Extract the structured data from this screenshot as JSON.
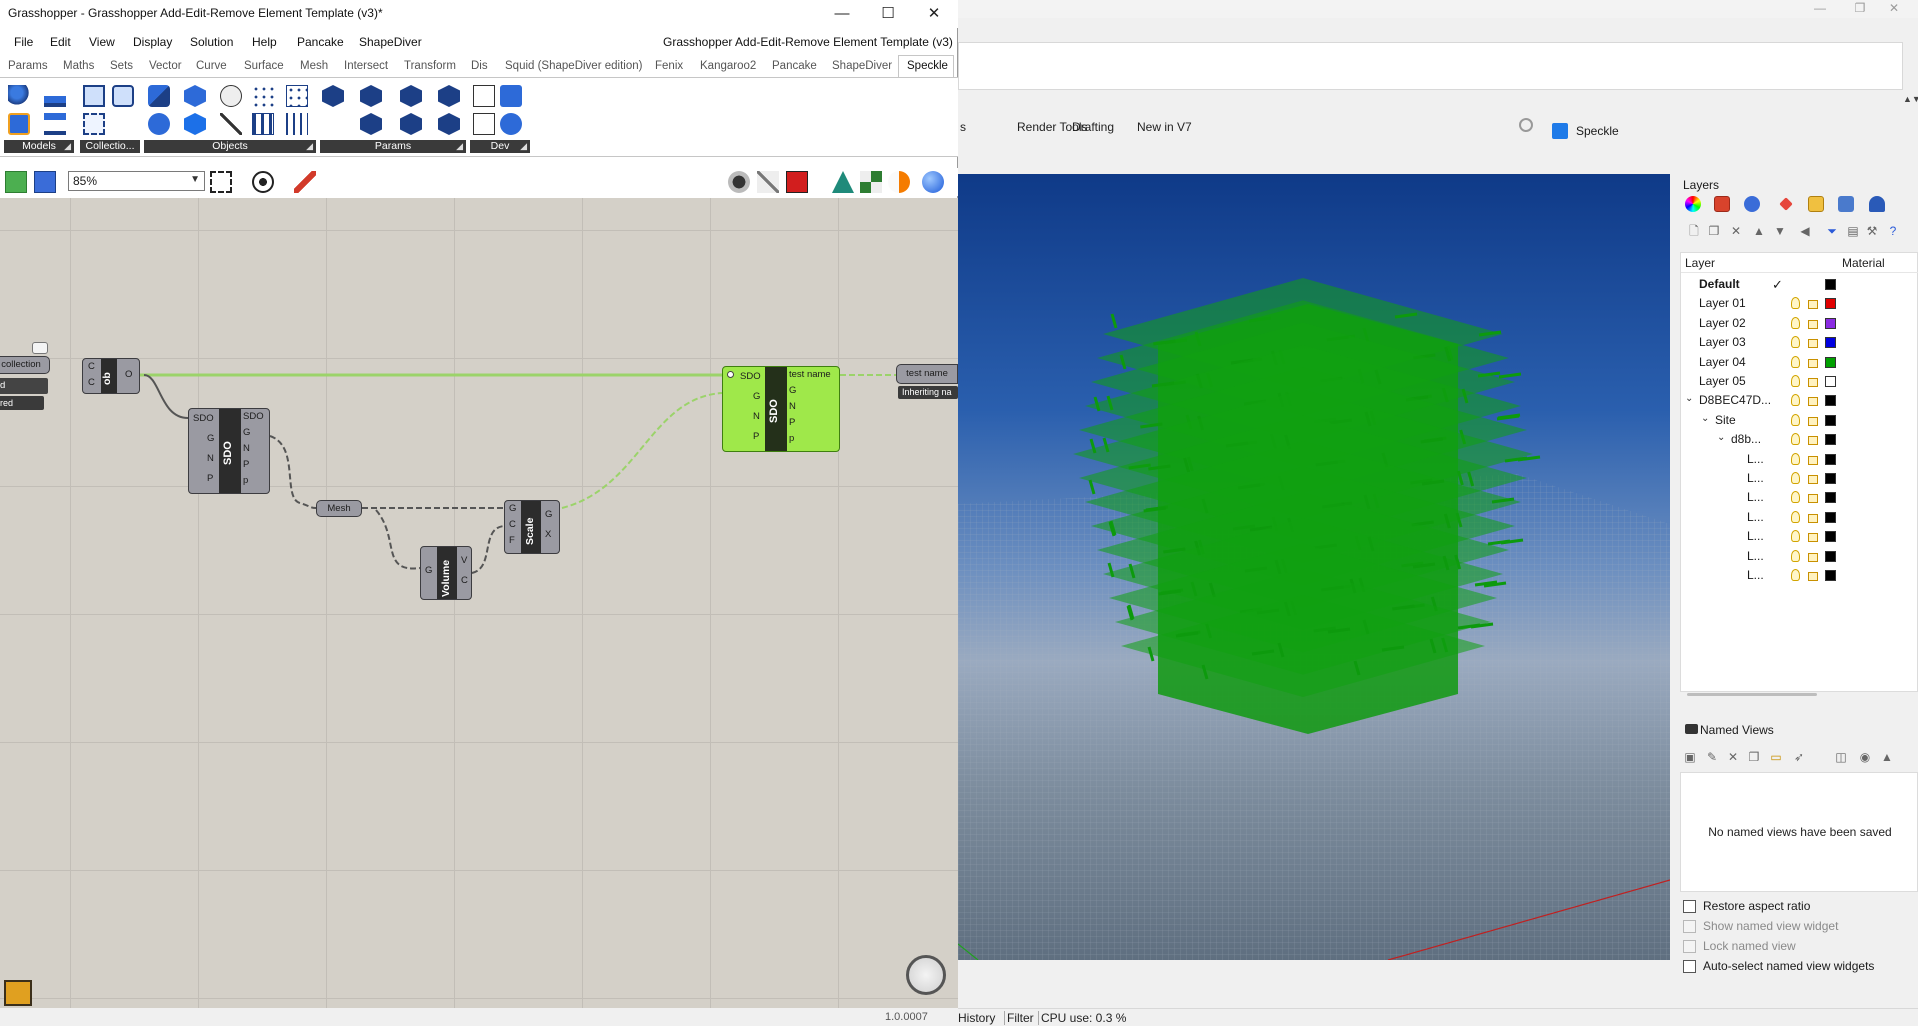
{
  "grasshopper": {
    "window_title": "Grasshopper - Grasshopper Add-Edit-Remove Element Template (v3)*",
    "doc_title": "Grasshopper Add-Edit-Remove Element Template (v3)",
    "window_controls": {
      "minimize": "—",
      "maximize": "☐",
      "close": "✕"
    },
    "menus": [
      "File",
      "Edit",
      "View",
      "Display",
      "Solution",
      "Help",
      "Pancake",
      "ShapeDiver"
    ],
    "tabs": [
      "Params",
      "Maths",
      "Sets",
      "Vector",
      "Curve",
      "Surface",
      "Mesh",
      "Intersect",
      "Transform",
      "Dis",
      "Squid (ShapeDiver edition)",
      "Fenix",
      "Kangaroo2",
      "Pancake",
      "ShapeDiver",
      "Speckle"
    ],
    "active_tab": "Speckle",
    "ribbon_groups": [
      "Models",
      "Collectio...",
      "Objects",
      "Params",
      "Dev"
    ],
    "zoom": "85%",
    "version": "1.0.0007",
    "canvas": {
      "collection_param": "collection",
      "collection_small": "d",
      "collection_tag": "red",
      "ob_nick": "ob",
      "ob_inputs": [
        "C",
        "C"
      ],
      "ob_output": "O",
      "sdo_left": {
        "nick": "SDO",
        "inputs": [
          "SDO",
          "G",
          "N",
          "P"
        ],
        "outputs": [
          "SDO",
          "G",
          "N",
          "P",
          "p"
        ]
      },
      "sdo_right": {
        "nick": "SDO",
        "inputs": [
          "SDO",
          "G",
          "N",
          "P"
        ],
        "outputs": [
          "test name",
          "G",
          "N",
          "P",
          "p"
        ]
      },
      "mesh_param": "Mesh",
      "scale": {
        "nick": "Scale",
        "inputs": [
          "G",
          "C",
          "F"
        ],
        "outputs": [
          "G",
          "X"
        ]
      },
      "volume": {
        "nick": "Volume",
        "inputs": [
          "G"
        ],
        "outputs": [
          "V",
          "C"
        ]
      },
      "panel_label": "test name",
      "panel_tag": "Inheriting na"
    }
  },
  "rhino": {
    "window_controls": {
      "minimize": "—",
      "maximize": "❐",
      "close": "✕"
    },
    "tabs": [
      "s",
      "Render Tools",
      "Drafting",
      "New in V7"
    ],
    "side_tab": "Speckle",
    "layers": {
      "title": "Layers",
      "col_layer": "Layer",
      "col_material": "Material",
      "rows": [
        {
          "name": "Default",
          "indent": 0,
          "bold": true,
          "current": true,
          "color": "#000000"
        },
        {
          "name": "Layer 01",
          "indent": 0,
          "color": "#e00000"
        },
        {
          "name": "Layer 02",
          "indent": 0,
          "color": "#8a2be2"
        },
        {
          "name": "Layer 03",
          "indent": 0,
          "color": "#0000e0"
        },
        {
          "name": "Layer 04",
          "indent": 0,
          "color": "#00a000"
        },
        {
          "name": "Layer 05",
          "indent": 0,
          "color": "#ffffff"
        },
        {
          "name": "D8BEC47D...",
          "indent": 0,
          "expander": true,
          "color": "#000000"
        },
        {
          "name": "Site",
          "indent": 1,
          "expander": true,
          "color": "#000000"
        },
        {
          "name": "d8b...",
          "indent": 2,
          "expander": true,
          "color": "#000000"
        },
        {
          "name": "L...",
          "indent": 3,
          "color": "#000000"
        },
        {
          "name": "L...",
          "indent": 3,
          "color": "#000000"
        },
        {
          "name": "L...",
          "indent": 3,
          "color": "#000000"
        },
        {
          "name": "L...",
          "indent": 3,
          "color": "#000000"
        },
        {
          "name": "L...",
          "indent": 3,
          "color": "#000000"
        },
        {
          "name": "L...",
          "indent": 3,
          "color": "#000000"
        },
        {
          "name": "L...",
          "indent": 3,
          "color": "#000000"
        }
      ]
    },
    "named_views": {
      "title": "Named Views",
      "empty_text": "No named views have been saved",
      "options": [
        {
          "label": "Restore aspect ratio",
          "enabled": true
        },
        {
          "label": "Show named view widget",
          "enabled": false
        },
        {
          "label": "Lock named view",
          "enabled": false
        },
        {
          "label": "Auto-select named view widgets",
          "enabled": true
        }
      ]
    },
    "status": {
      "history": "History",
      "filter": "Filter",
      "cpu": "CPU use: 0.3 %"
    }
  }
}
